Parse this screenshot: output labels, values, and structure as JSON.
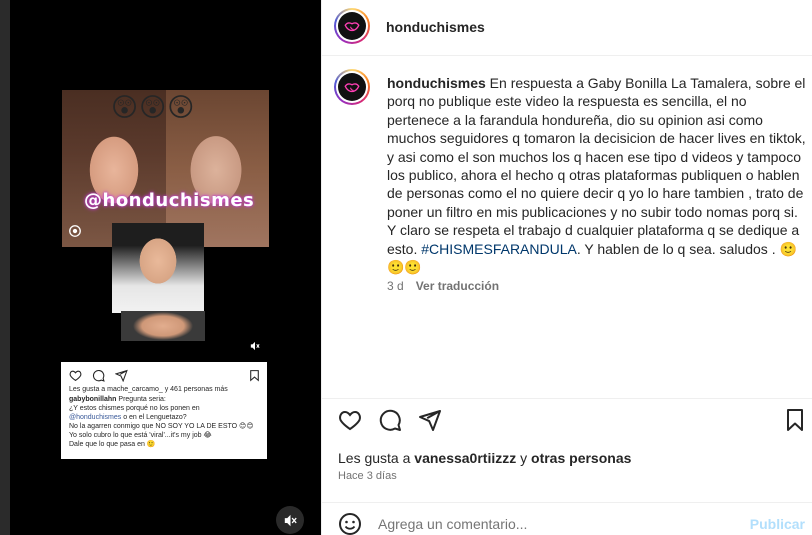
{
  "media": {
    "emojis": "😲😲😲",
    "watermark": "@honduchismes",
    "embedded_post": {
      "likes": "Les gusta a mache_carcamo_ y 461 personas más",
      "lines": [
        {
          "user": "gabybonillahn",
          "text": " Pregunta seria:"
        },
        {
          "text": "¿Y estos chismes porqué no los ponen en"
        },
        {
          "link": "@honduchismes",
          "text": " o en el Lenguetazo?"
        },
        {
          "text": "No la agarren conmigo que NO SOY YO LA DE ESTO 😊😊"
        },
        {
          "text": "Yo solo cubro lo que está 'viral'...it's my job 😂"
        },
        {
          "text": "Dale que lo que pasa en 🙂"
        }
      ]
    },
    "icons": {
      "camera": "camera-icon",
      "mute_small": "mute-icon",
      "mute_big": "mute-icon"
    }
  },
  "post": {
    "username": "honduchismes",
    "caption": {
      "username": "honduchismes",
      "text": " En respuesta a Gaby Bonilla La Tamalera, sobre el porq no publique este video la respuesta es sencilla, el no pertenece a la farandula hondureña, dio su opinion asi como muchos seguidores q tomaron la decisicion de hacer lives en tiktok, y asi como el son muchos los q hacen ese tipo d videos y tampoco los publico, ahora el hecho q otras plataformas publiquen o hablen de personas como el no quiere decir q yo lo hare tambien , trato de poner un filtro en mis publicaciones y no subir todo nomas porq si. Y claro se respeta el trabajo d cualquier plataforma q se dedique a esto. ",
      "hashtag": "#CHISMESFARANDULA",
      "tail": ". Y hablen de lo q sea. saludos . 🙂🙂🙂"
    },
    "meta": {
      "age": "3 d",
      "translate": "Ver traducción"
    },
    "likes": {
      "prefix": "Les gusta a ",
      "user": "vanessa0rtiizzz",
      "middle": " y ",
      "others": "otras personas"
    },
    "time": "Hace 3 días",
    "comment": {
      "placeholder": "Agrega un comentario...",
      "publish": "Publicar"
    }
  },
  "colors": {
    "link": "#00376b",
    "publish_disabled": "#b2dffc",
    "secondary_text": "#737373"
  }
}
